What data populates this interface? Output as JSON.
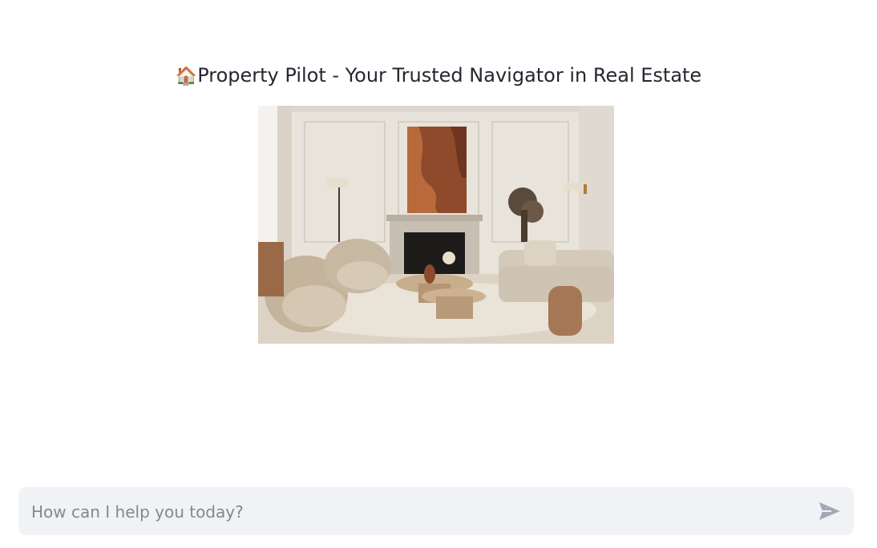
{
  "header": {
    "title_emoji": "🏠",
    "title_text": "Property Pilot - Your Trusted Navigator in Real Estate"
  },
  "hero_image": {
    "subject": "living-room-interior-photo"
  },
  "chat": {
    "placeholder": "How can I help you today?",
    "send_icon": "send-icon"
  },
  "colors": {
    "text": "#262730",
    "input_bg": "#f0f2f6",
    "placeholder": "#858791",
    "send_icon": "#a3a8b8"
  }
}
